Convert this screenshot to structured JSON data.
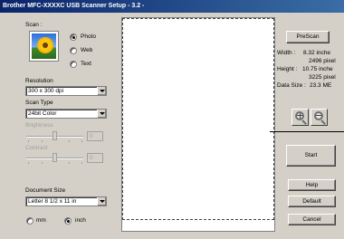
{
  "window": {
    "title": "Brother MFC-XXXXC USB Scanner Setup - 3.2 -"
  },
  "scan": {
    "label": "Scan :",
    "options": [
      "Photo",
      "Web",
      "Text"
    ],
    "selected": "Photo"
  },
  "resolution": {
    "label": "Resolution",
    "value": "300 x 300 dpi"
  },
  "scan_type": {
    "label": "Scan Type",
    "value": "24bit Color"
  },
  "brightness": {
    "label": "Brightness",
    "value": "0"
  },
  "contrast": {
    "label": "Contrast",
    "value": "0"
  },
  "document_size": {
    "label": "Document Size",
    "value": "Letter 8 1/2 x 11 in"
  },
  "units": {
    "options": [
      "mm",
      "inch"
    ],
    "selected": "inch"
  },
  "prescan_label": "PreScan",
  "info": {
    "width_label": "Width :",
    "width_inches": "8.32 inche",
    "width_pixels": "2496 pixel",
    "height_label": "Height :",
    "height_inches": "10.75 inche",
    "height_pixels": "3225 pixel",
    "data_size_label": "Data Size :",
    "data_size_value": "23.3 ME"
  },
  "zoom": {
    "zoom_in_icon": "zoom-in-icon",
    "zoom_out_icon": "zoom-out-icon"
  },
  "buttons": {
    "start": "Start",
    "help": "Help",
    "default": "Default",
    "cancel": "Cancel"
  }
}
